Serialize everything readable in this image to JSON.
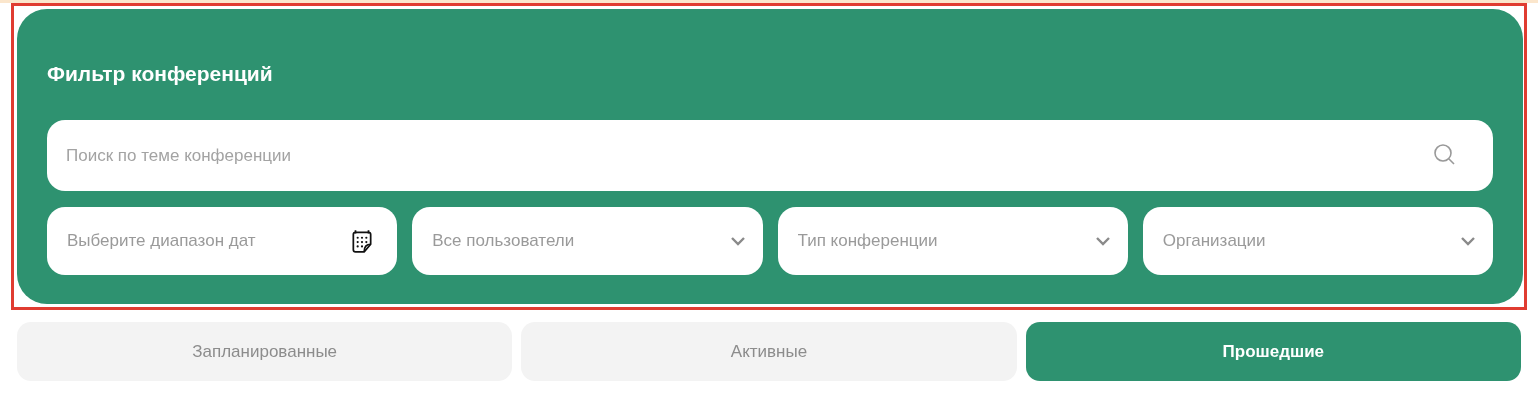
{
  "filter_panel": {
    "title": "Фильтр конференций",
    "search": {
      "placeholder": "Поиск по теме конференции"
    },
    "filters": [
      {
        "kind": "date",
        "placeholder": "Выберите диапазон дат"
      },
      {
        "kind": "select",
        "placeholder": "Все пользователи"
      },
      {
        "kind": "select",
        "placeholder": "Тип конференции"
      },
      {
        "kind": "select",
        "placeholder": "Организации"
      }
    ]
  },
  "tabs": [
    {
      "label": "Запланированные",
      "selected": false
    },
    {
      "label": "Активные",
      "selected": false
    },
    {
      "label": "Прошедшие",
      "selected": true
    }
  ]
}
